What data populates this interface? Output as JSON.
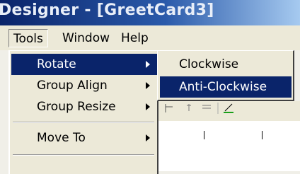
{
  "window": {
    "title": "Designer - [GreetCard3]"
  },
  "menubar": {
    "items": [
      {
        "label": "Tools"
      },
      {
        "label": "Window"
      },
      {
        "label": "Help"
      }
    ]
  },
  "tools_menu": {
    "items": [
      {
        "label": "Rotate",
        "has_submenu": true,
        "highlighted": true
      },
      {
        "label": "Group Align",
        "has_submenu": true
      },
      {
        "label": "Group Resize",
        "has_submenu": true
      },
      {
        "label": "Move To",
        "has_submenu": true
      }
    ]
  },
  "rotate_submenu": {
    "items": [
      {
        "label": "Clockwise"
      },
      {
        "label": "Anti-Clockwise",
        "highlighted": true
      }
    ]
  },
  "colors": {
    "highlight": "#0a246a",
    "menu_bg": "#ece9d8",
    "title_start": "#0a246a",
    "title_end": "#a6caf0"
  }
}
